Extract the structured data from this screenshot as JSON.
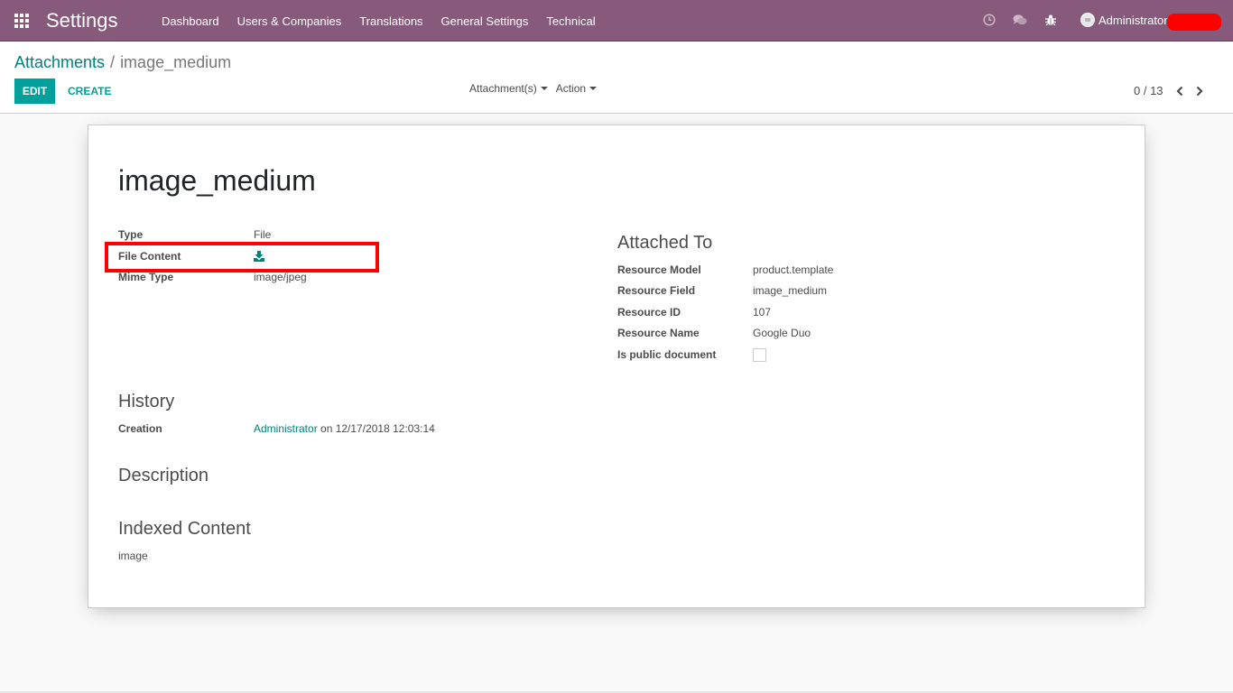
{
  "navbar": {
    "app_title": "Settings",
    "menu": [
      "Dashboard",
      "Users & Companies",
      "Translations",
      "General Settings",
      "Technical"
    ],
    "icons": [
      "clock-icon",
      "chat-icon",
      "bug-icon"
    ],
    "user_name": "Administrator",
    "brand_color": "#875a7b"
  },
  "control": {
    "breadcrumb": {
      "parent": "Attachments",
      "separator": "/",
      "current": "image_medium"
    },
    "edit_label": "EDIT",
    "create_label": "CREATE",
    "dropdowns": [
      "Attachment(s)",
      "Action"
    ],
    "pager": "0 / 13",
    "accent_color": "#00a09d"
  },
  "record": {
    "title": "image_medium",
    "left_fields": [
      {
        "label": "Type",
        "value": "File"
      },
      {
        "label": "File Content",
        "value": "download-icon"
      },
      {
        "label": "Mime Type",
        "value": "image/jpeg"
      }
    ],
    "attached_to": {
      "heading": "Attached To",
      "fields": [
        {
          "label": "Resource Model",
          "value": "product.template"
        },
        {
          "label": "Resource Field",
          "value": "image_medium"
        },
        {
          "label": "Resource ID",
          "value": "107"
        },
        {
          "label": "Resource Name",
          "value": "Google Duo"
        },
        {
          "label": "Is public document",
          "value": false
        }
      ]
    },
    "history": {
      "heading": "History",
      "creation_label": "Creation",
      "creation_user": "Administrator",
      "creation_date": " on 12/17/2018 12:03:14"
    },
    "description": {
      "heading": "Description"
    },
    "indexed_content": {
      "heading": "Indexed Content",
      "value": "image"
    }
  }
}
